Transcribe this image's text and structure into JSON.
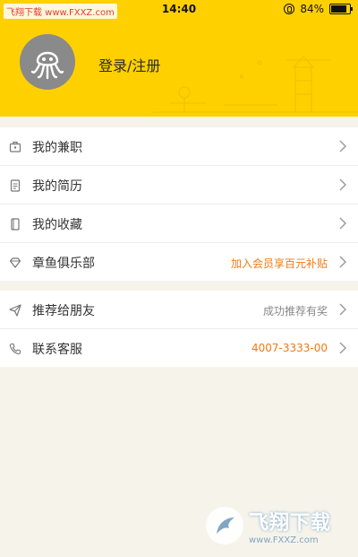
{
  "status_bar": {
    "watermark": "飞翔下载 www.FXXZ.com",
    "time": "14:40",
    "battery": "84%",
    "battery_level": 0.84
  },
  "header": {
    "login_label": "登录/注册"
  },
  "menu_primary": [
    {
      "label": "我的兼职",
      "icon": "briefcase-icon"
    },
    {
      "label": "我的简历",
      "icon": "document-icon"
    },
    {
      "label": "我的收藏",
      "icon": "bookmark-icon"
    },
    {
      "label": "章鱼俱乐部",
      "icon": "diamond-icon",
      "right_text": "加入会员享百元补贴"
    }
  ],
  "menu_secondary": [
    {
      "label": "推荐给朋友",
      "icon": "send-icon",
      "right_text": "成功推荐有奖"
    },
    {
      "label": "联系客服",
      "icon": "phone-icon",
      "right_text": "4007-3333-00"
    }
  ],
  "bottom_watermark": {
    "title": "飞翔下载",
    "url": "www.FXXZ.com"
  },
  "colors": {
    "header": "#ffd000",
    "accent_orange": "#f07a14",
    "background": "#f6f3ea"
  }
}
